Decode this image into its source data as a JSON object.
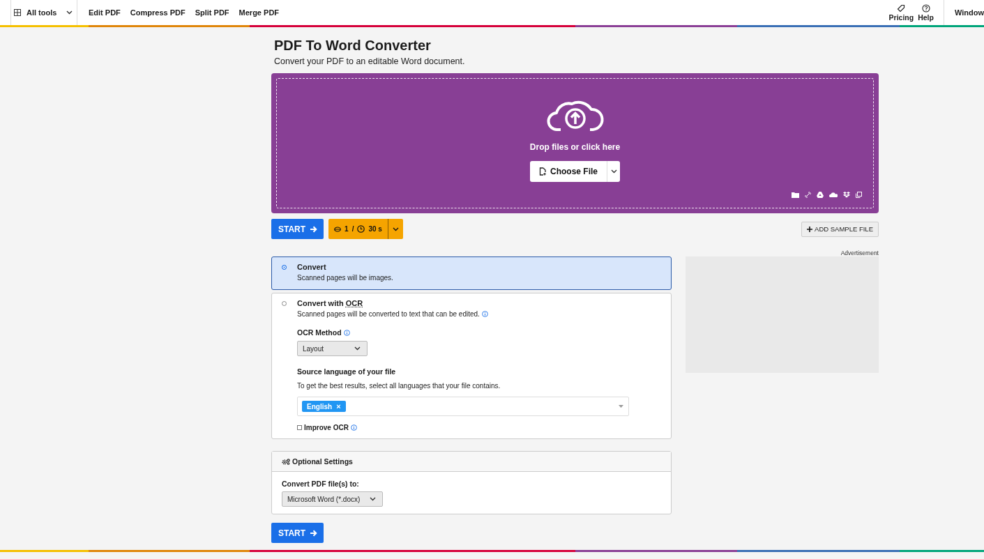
{
  "header": {
    "menu": "All tools",
    "links": [
      "Edit PDF",
      "Compress PDF",
      "Split PDF",
      "Merge PDF"
    ],
    "right": [
      "Pricing",
      "Help"
    ],
    "window": "Window"
  },
  "page": {
    "title": "PDF To Word Converter",
    "subtitle": "Convert your PDF to an editable Word document."
  },
  "upload": {
    "prompt": "Drop files or click here",
    "button": "Choose File"
  },
  "actions": {
    "start": "START",
    "quota_count": "1",
    "quota_separator": "/",
    "quota_time": "30 s",
    "sample": "ADD SAMPLE FILE"
  },
  "ad_label": "Advertisement",
  "modes": [
    {
      "title": "Convert",
      "description": "Scanned pages will be images.",
      "selected": true
    },
    {
      "title": "Convert with",
      "abbr": "OCR",
      "description": "Scanned pages will be converted to text that can be edited.",
      "selected": false
    }
  ],
  "ocr": {
    "method_label": "OCR Method",
    "method": "Layout",
    "language_label": "Source language of your file",
    "language_hint": "To get the best results, select all languages that your file contains.",
    "languages": [
      {
        "label": "English",
        "remove": "×"
      }
    ],
    "improve": {
      "label": "Improve OCR",
      "checked": false
    }
  },
  "optional": {
    "title": "Optional Settings",
    "format_label": "Convert PDF file(s) to:",
    "format": "Microsoft Word (*.docx)"
  },
  "start_bottom": "START"
}
